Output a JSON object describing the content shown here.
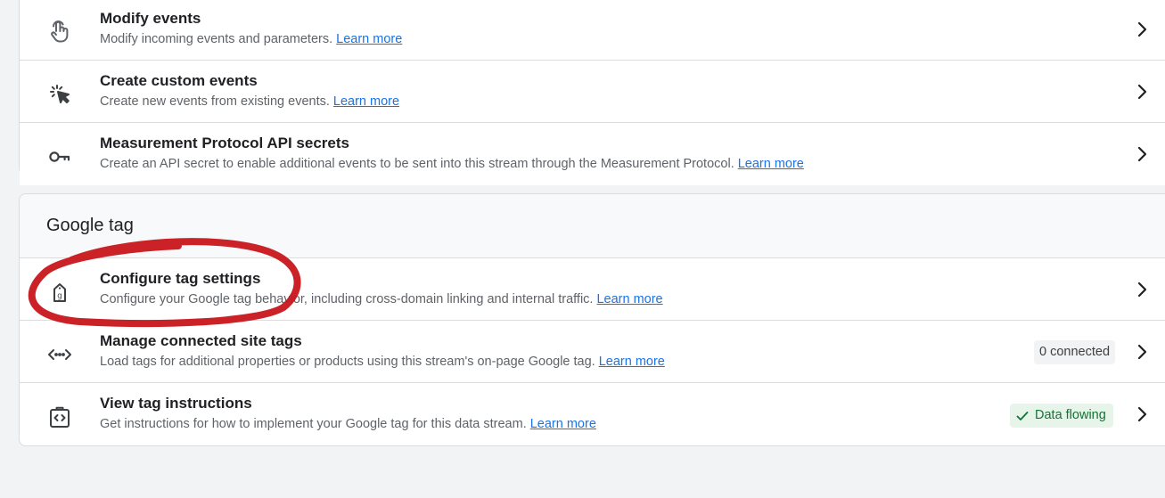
{
  "top_card": {
    "rows": [
      {
        "icon": "touch-gesture-icon",
        "title": "Modify events",
        "description": "Modify incoming events and parameters.",
        "link": "Learn more"
      },
      {
        "icon": "click-sparkle-icon",
        "title": "Create custom events",
        "description": "Create new events from existing events.",
        "link": "Learn more"
      },
      {
        "icon": "key-icon",
        "title": "Measurement Protocol API secrets",
        "description": "Create an API secret to enable additional events to be sent into this stream through the Measurement Protocol.",
        "link": "Learn more"
      }
    ]
  },
  "google_tag_card": {
    "title": "Google tag",
    "rows": [
      {
        "icon": "tag-g-icon",
        "title": "Configure tag settings",
        "description": "Configure your Google tag behavior, including cross-domain linking and internal traffic.",
        "link": "Learn more"
      },
      {
        "icon": "code-arrows-icon",
        "title": "Manage connected site tags",
        "description": "Load tags for additional properties or products using this stream's on-page Google tag.",
        "link": "Learn more",
        "badge": "0 connected"
      },
      {
        "icon": "clipboard-code-icon",
        "title": "View tag instructions",
        "description": "Get instructions for how to implement your Google tag for this data stream.",
        "link": "Learn more",
        "badge": "Data flowing"
      }
    ]
  },
  "colors": {
    "page_background": "#f1f3f4",
    "link": "#1a73e8",
    "status_green": "#137333",
    "status_green_bg": "#e6f4ea",
    "annotation_red": "#c8161c"
  }
}
